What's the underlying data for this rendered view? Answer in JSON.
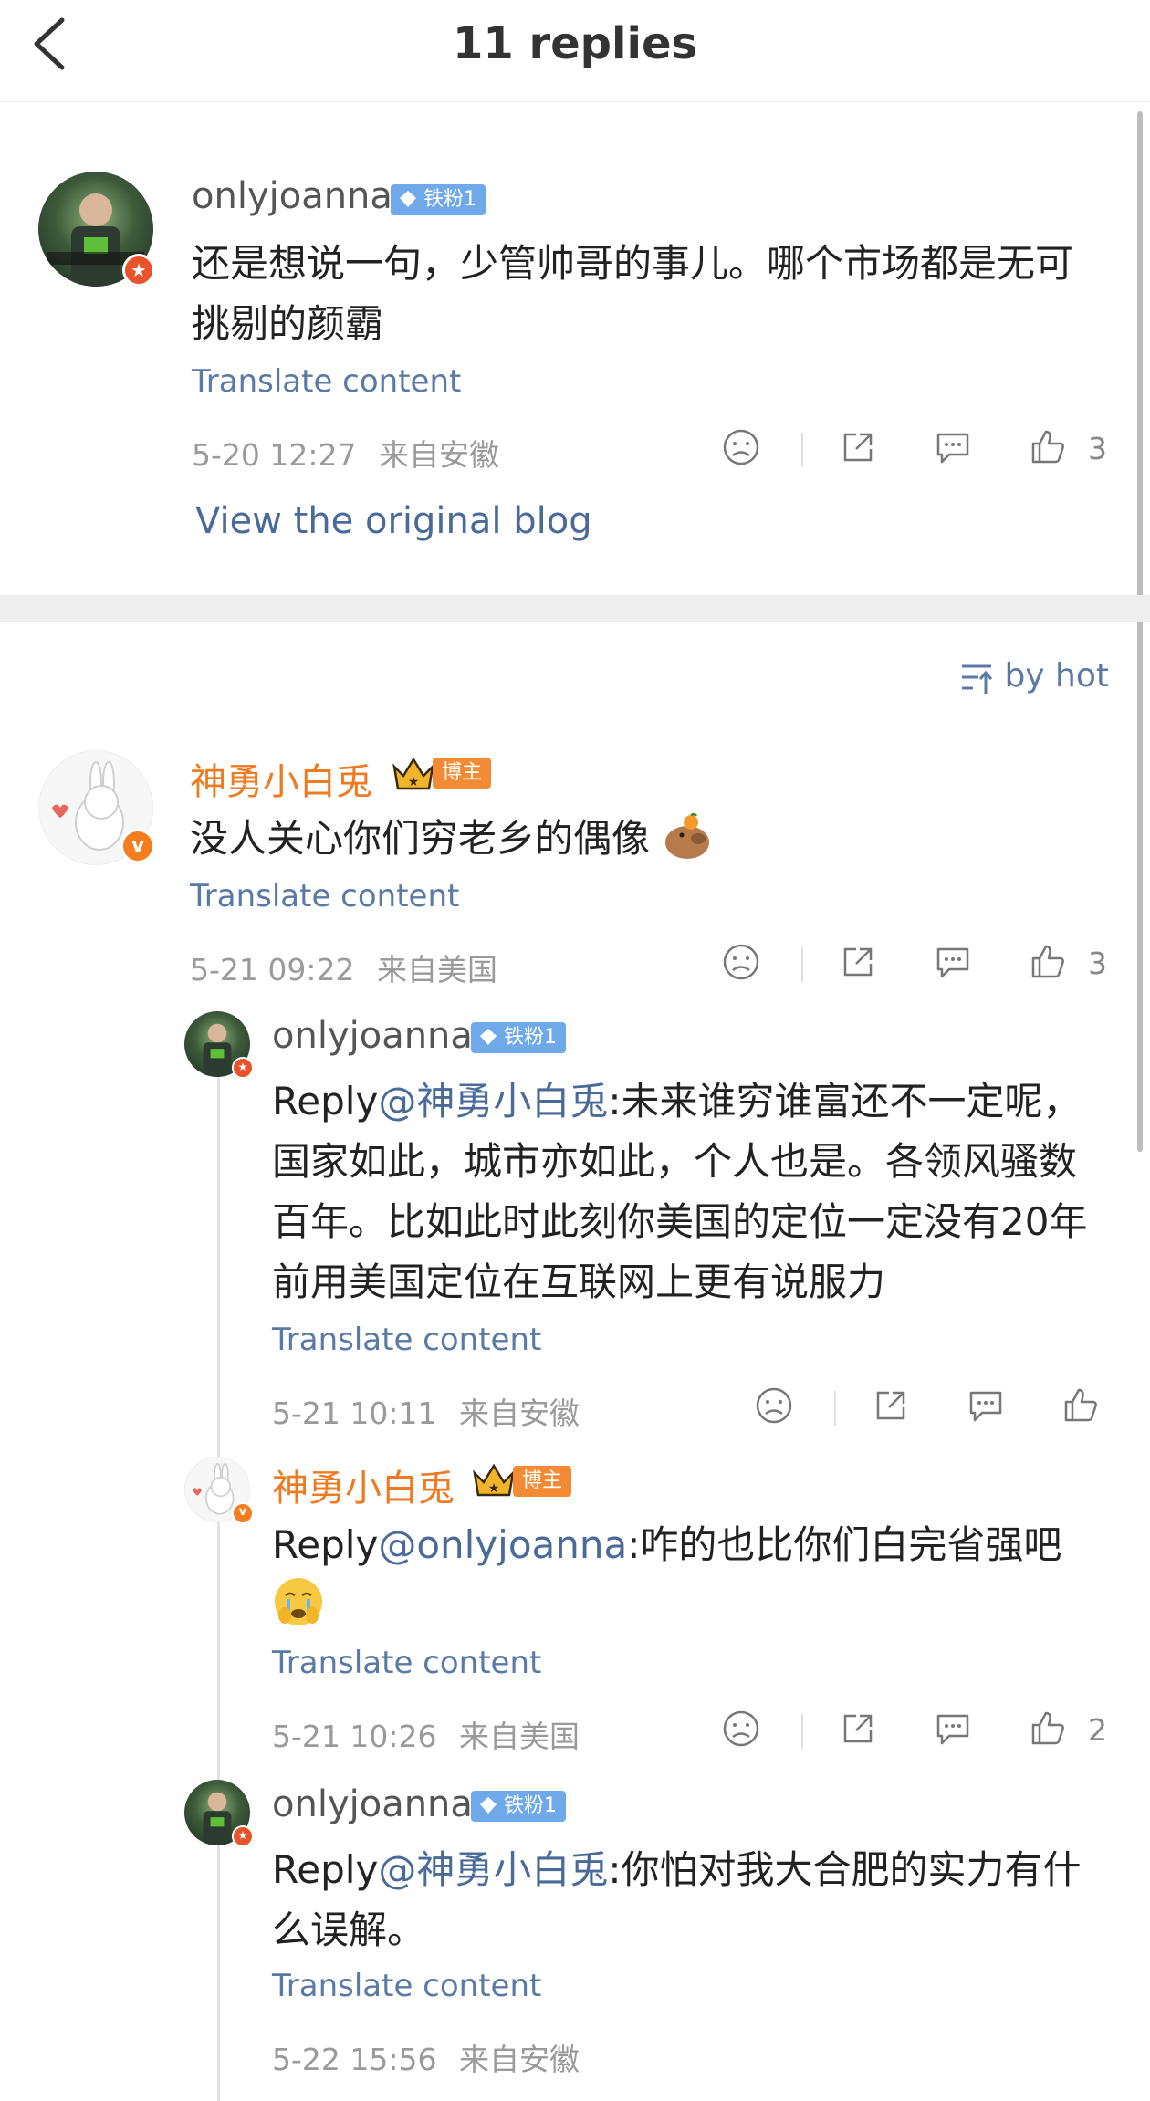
{
  "header": {
    "title": "11 replies",
    "back_icon": "chevron-left-icon"
  },
  "original_comment": {
    "username": "onlyjoanna",
    "fan_badge": "铁粉1",
    "text": "还是想说一句，少管帅哥的事儿。哪个市场都是无可挑剔的颜霸",
    "translate_label": "Translate content",
    "timestamp": "5-20 12:27",
    "location": "来自安徽",
    "like_count": "3",
    "view_original_label": "View the original blog"
  },
  "sort": {
    "label": "by hot",
    "icon": "sort-icon"
  },
  "replies": [
    {
      "username": "神勇小白兎",
      "badge": "博主",
      "text": "没人关心你们穷老乡的偶像",
      "translate_label": "Translate content",
      "timestamp": "5-21 09:22",
      "location": "来自美国",
      "like_count": "3"
    },
    {
      "username": "onlyjoanna",
      "fan_badge": "铁粉1",
      "reply_prefix": "Reply",
      "mention": "@神勇小白兎",
      "text": ":未来谁穷谁富还不一定呢，国家如此，城市亦如此，个人也是。各领风骚数百年。比如此时此刻你美国的定位一定没有20年前用美国定位在互联网上更有说服力",
      "translate_label": "Translate content",
      "timestamp": "5-21 10:11",
      "location": "来自安徽",
      "like_count": ""
    },
    {
      "username": "神勇小白兎",
      "badge": "博主",
      "reply_prefix": "Reply",
      "mention": "@onlyjoanna",
      "text": ":咋的也比你们白完省强吧",
      "translate_label": "Translate content",
      "timestamp": "5-21 10:26",
      "location": "来自美国",
      "like_count": "2"
    },
    {
      "username": "onlyjoanna",
      "fan_badge": "铁粉1",
      "reply_prefix": "Reply",
      "mention": "@神勇小白兎",
      "text": ":你怕对我大合肥的实力有什么误解。",
      "translate_label": "Translate content",
      "timestamp": "5-22 15:56",
      "location": "来自安徽"
    }
  ],
  "colors": {
    "accent_orange": "#ee7b22",
    "link_blue": "#4a6a9a",
    "fan_badge_blue": "#6fa9ea",
    "meta_gray": "#9a9a9a"
  }
}
